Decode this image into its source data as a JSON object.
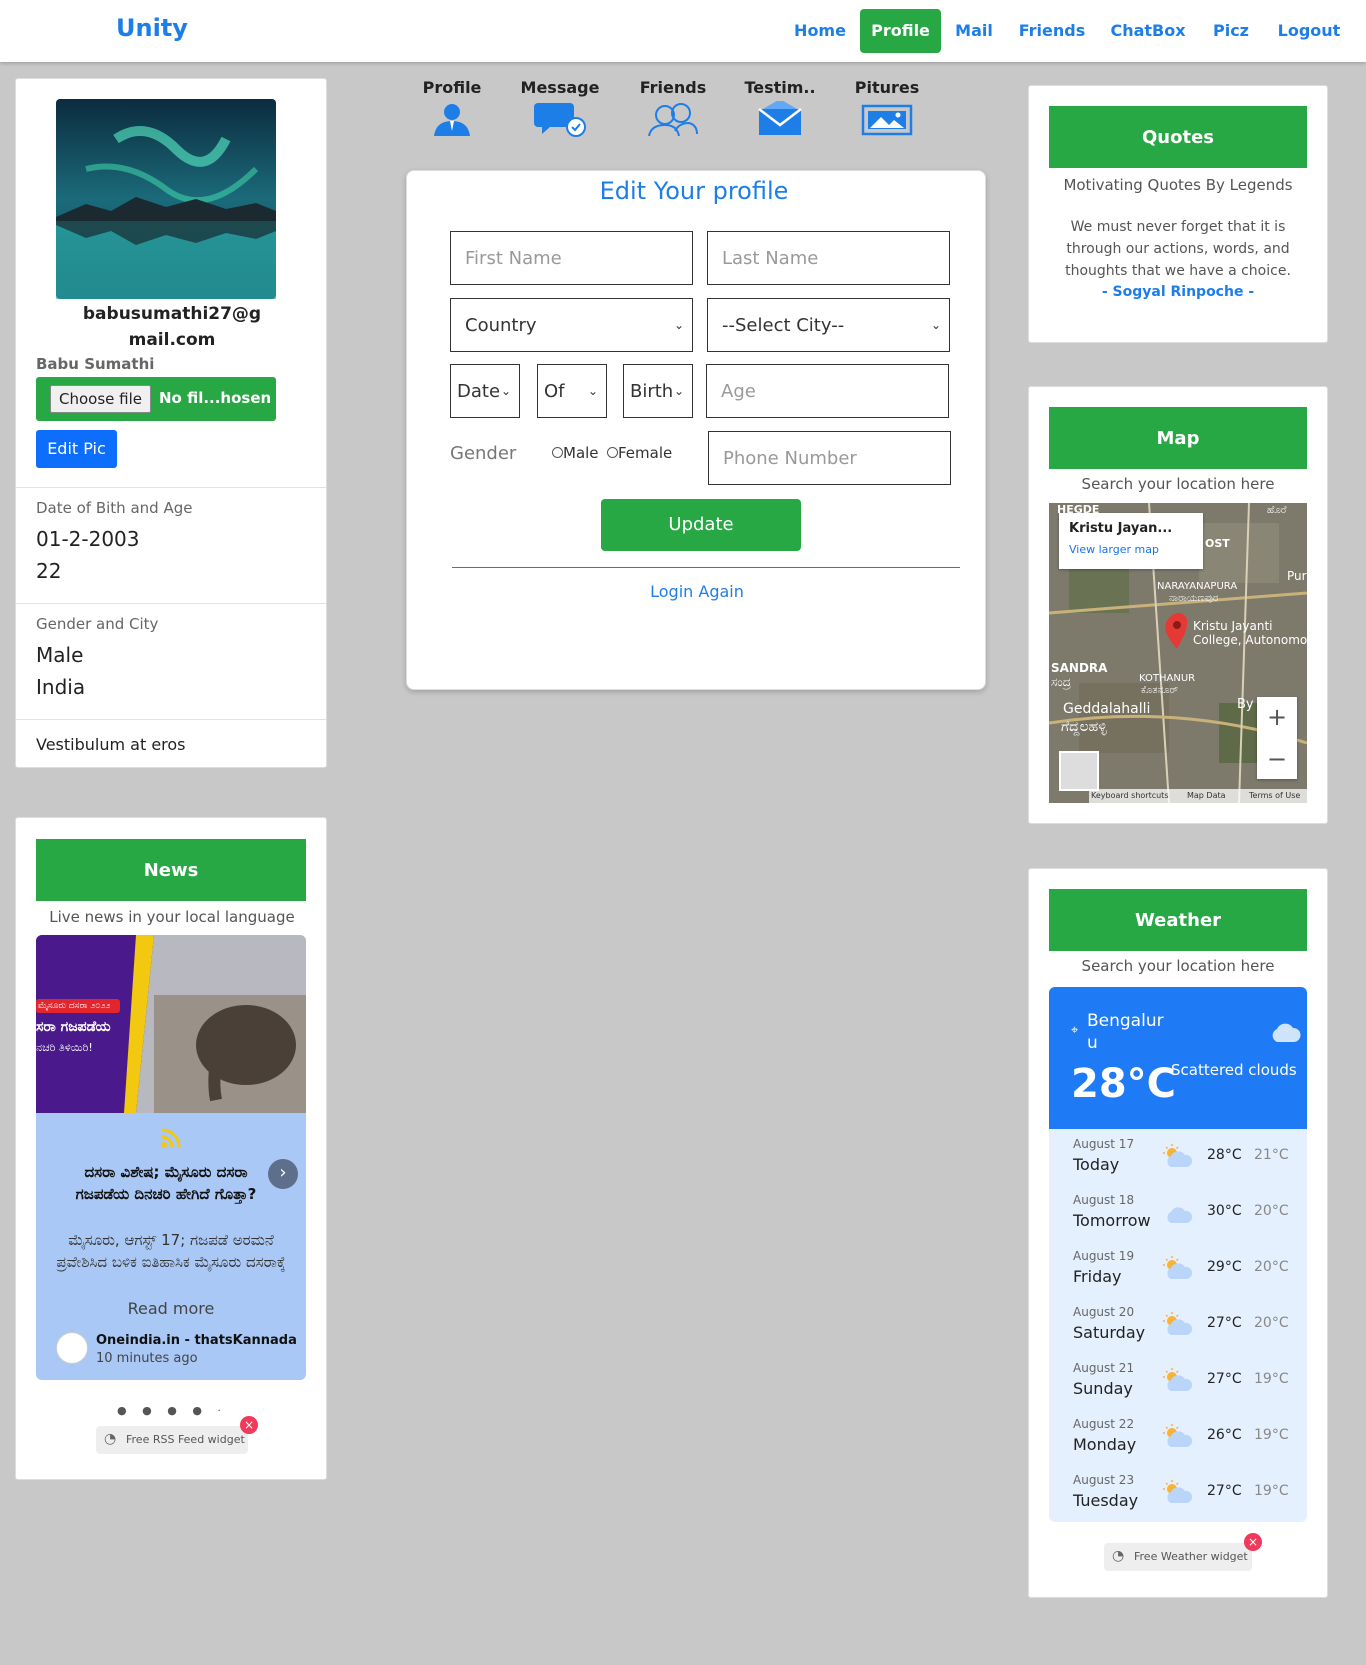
{
  "nav": {
    "brand": "Unity",
    "links": [
      "Home",
      "Profile",
      "Mail",
      "Friends",
      "ChatBox",
      "Picz",
      "Logout"
    ],
    "active": "Profile",
    "accent_color": "#1e7ee8",
    "active_color": "#28a745"
  },
  "profile": {
    "email_line1": "babusumathi27@g",
    "email_line2": "mail.com",
    "name": "Babu Sumathi",
    "file_button": "Choose file",
    "file_status": "No fil...hosen",
    "edit_pic": "Edit Pic",
    "dob_label": "Date of Bith and Age",
    "dob": "01-2-2003",
    "age": "22",
    "gender_label": "Gender and City",
    "gender": "Male",
    "city": "India",
    "footer": "Vestibulum at eros"
  },
  "tabs": [
    "Profile",
    "Message",
    "Friends",
    "Testim..",
    "Pitures"
  ],
  "form": {
    "title": "Edit Your profile",
    "first_name": "First Name",
    "last_name": "Last Name",
    "country": "Country",
    "city": "--Select City--",
    "date": "Date",
    "of": "Of",
    "birth": "Birth",
    "age": "Age",
    "gender_label": "Gender",
    "male": "Male",
    "female": "Female",
    "phone": "Phone Number",
    "update": "Update",
    "login_again": "Login Again"
  },
  "quotes": {
    "title": "Quotes",
    "subtitle": "Motivating Quotes By Legends",
    "text": "We must never forget that it is through our actions, words, and thoughts that we have a choice.",
    "author": "- Sogyal Rinpoche -"
  },
  "map": {
    "title": "Map",
    "subtitle": "Search your location here",
    "place": "Kristu Jayan...",
    "view_larger": "View larger map",
    "marker_label_1": "Kristu Jayanti",
    "marker_label_2": "College, Autonomo",
    "area_1": "NARAYANAPURA",
    "area_2": "ನಾರಾಯಣಪುರ",
    "area_3": "SANDRA",
    "area_4": "ಸಂದ್ರ",
    "area_5": "KOTHANUR",
    "area_6": "ಕೊತನೂರ್",
    "area_7": "Geddalahalli",
    "area_8": "ಗೆದ್ದಲಹಳ್ಳಿ",
    "area_9": "HEGDE",
    "area_10": "ಹೊರೆ",
    "area_11": "OST",
    "area_12": "Pur",
    "area_13": "By",
    "footer_1": "Keyboard shortcuts",
    "footer_2": "Map Data",
    "footer_3": "Terms of Use",
    "zoom_in": "+",
    "zoom_out": "−"
  },
  "news": {
    "title": "News",
    "subtitle": "Live news in your local language",
    "image_tag": "ಮೈಸೂರು ದಸರಾ ೨೦೨೨",
    "image_line1": "ಸರಾ ಗಜಪಡೆಯ",
    "image_line2": "ನಚರಿ ತಿಳಿಯಿರಿ!",
    "headline": "ದಸರಾ ವಿಶೇಷ; ಮೈಸೂರು ದಸರಾ ಗಜಪಡೆಯ ದಿನಚರಿ ಹೇಗಿದೆ ಗೊತ್ತಾ?",
    "body": "ಮೈಸೂರು, ಆಗಸ್ಟ್ 17; ಗಜಪಡೆ ಅರಮನೆ ಪ್ರವೇಶಿಸಿದ ಬಳಿಕ ಐತಿಹಾಸಿಕ ಮೈಸೂರು ದಸರಾಕ್ಕೆ",
    "read_more": "Read more",
    "source": "Oneindia.in - thatsKannada",
    "time": "10 minutes ago",
    "widget_label": "Free RSS Feed widget"
  },
  "weather": {
    "title": "Weather",
    "subtitle": "Search your location here",
    "city_line1": "Bengalur",
    "city_line2": "u",
    "temp": "28°C",
    "condition": "Scattered clouds",
    "days": [
      {
        "date": "August 17",
        "name": "Today",
        "hi": "28°C",
        "lo": "21°C",
        "icon": "sun-cloud-icon"
      },
      {
        "date": "August 18",
        "name": "Tomorrow",
        "hi": "30°C",
        "lo": "20°C",
        "icon": "cloud-icon"
      },
      {
        "date": "August 19",
        "name": "Friday",
        "hi": "29°C",
        "lo": "20°C",
        "icon": "sun-cloud-icon"
      },
      {
        "date": "August 20",
        "name": "Saturday",
        "hi": "27°C",
        "lo": "20°C",
        "icon": "sun-cloud-icon"
      },
      {
        "date": "August 21",
        "name": "Sunday",
        "hi": "27°C",
        "lo": "19°C",
        "icon": "sun-cloud-icon"
      },
      {
        "date": "August 22",
        "name": "Monday",
        "hi": "26°C",
        "lo": "19°C",
        "icon": "sun-cloud-icon"
      },
      {
        "date": "August 23",
        "name": "Tuesday",
        "hi": "27°C",
        "lo": "19°C",
        "icon": "sun-cloud-icon"
      }
    ],
    "widget_label": "Free Weather widget"
  }
}
